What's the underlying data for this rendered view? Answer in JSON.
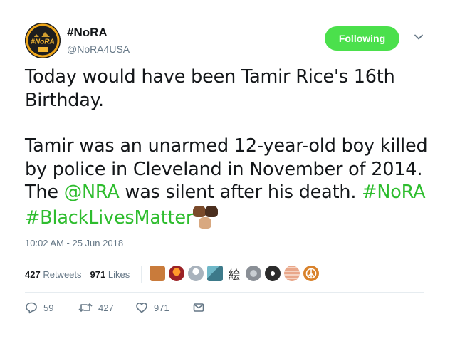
{
  "author": {
    "display_name": "#NoRA",
    "handle": "@NoRA4USA",
    "avatar_text": "#NoRA",
    "avatar_colors": {
      "ring": "#f0a71a",
      "inner": "#1e1e1e",
      "text": "#f2b632"
    }
  },
  "follow_button": {
    "label": "Following",
    "color": "#4be04c"
  },
  "tweet": {
    "para1": "Today would have been Tamir Rice's 16th Birthday.",
    "para2_a": "Tamir was an unarmed 12-year-old boy killed by police in Cleveland in November of 2014. The ",
    "mention": "@NRA",
    "para2_b": " was silent after his death.  ",
    "hashtag1": "#NoRA",
    "hashtag2": "#BlackLivesMatter",
    "emoji": "raised-fist-icons",
    "link_color": "#2ebd2e"
  },
  "timestamp": "10:02 AM - 25 Jun 2018",
  "stats": {
    "retweets_count": "427",
    "retweets_label": "Retweets",
    "likes_count": "971",
    "likes_label": "Likes"
  },
  "likers": [
    {
      "icon": "avatar-1",
      "color": "#c97b3b"
    },
    {
      "icon": "avatar-2",
      "color": "#9b2226"
    },
    {
      "icon": "avatar-3",
      "color": "#a9b3bd"
    },
    {
      "icon": "avatar-4",
      "color": "#3d7a8a"
    },
    {
      "icon": "avatar-5-kanji",
      "text": "絵"
    },
    {
      "icon": "avatar-6",
      "color": "#8a8f96"
    },
    {
      "icon": "avatar-7",
      "color": "#2b2b2b"
    },
    {
      "icon": "avatar-8",
      "color": "#e9a78a"
    },
    {
      "icon": "avatar-9",
      "color": "#d9822b"
    }
  ],
  "actions": {
    "replies": "59",
    "retweets": "427",
    "likes": "971"
  }
}
